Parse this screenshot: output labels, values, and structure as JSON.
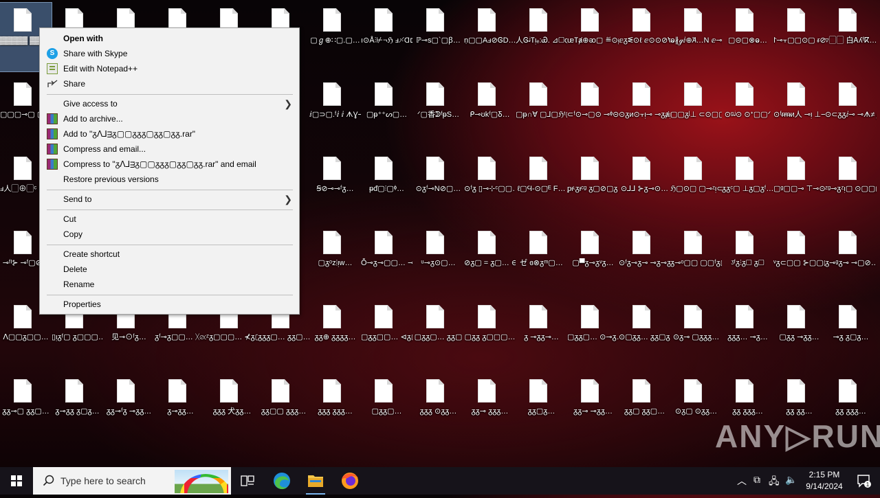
{
  "desktop": {
    "icons": [
      {
        "label": "▓▓▓▓▓ ▓▓▓ ic▢ ▀▀"
      },
      {
        "label": ""
      },
      {
        "label": ""
      },
      {
        "label": ""
      },
      {
        "label": ""
      },
      {
        "label": ""
      },
      {
        "label": "▢ℊ⊕∷▢.▢…"
      },
      {
        "label": "ı⊙Å⫶⊬¬ℌ ⅎ⸓Ɑ⊏ﾭ…"
      },
      {
        "label": "ℙ⊸ѕ▢`▢ꞵ…"
      },
      {
        "label": "ṇ▢▢Aⅎ⊘ᎶD…"
      },
      {
        "label": "人Ꮆᶨⴶᴉₑ:Ꮿ. ⊿▢ꝗ"
      },
      {
        "label": "ᵫⴶⱥ⊕ᴔ▢ ≝⊙ᵽ≣ᵂ…"
      },
      {
        "label": "ⅇᵹᓬ⊙ℓ ⅇ⊙⊙⊘Ɐ…"
      },
      {
        "label": "ⱺ∦ℊⅈ⊕Ꞻ…N ⅇ⊸ᵽ⁻ⁿ…"
      },
      {
        "label": "▢⊝▢⊗ⱺ…"
      },
      {
        "label": "⨡⊸⫟▢▢⊙▢ ᵲ⊘ꝗ夗…"
      },
      {
        "label": "▿▢▢ 白Ꭺʎᶠⴽ…"
      },
      {
        "label": "▢▢▢⊸▢ ▢●ᵽⴶᵳ…"
      },
      {
        "label": ""
      },
      {
        "label": ""
      },
      {
        "label": ""
      },
      {
        "label": ""
      },
      {
        "label": ""
      },
      {
        "label": "ⅈ▢⊃▢.ᶠⅈ ⅈ ᗑƔ⊸ℌ▢…"
      },
      {
        "label": "▢ᵽ⁺⁺ᔕ▢…"
      },
      {
        "label": "ᐟ▢香ᕲᶠᵽS…"
      },
      {
        "label": "ᑭ⊸ʊkᶠ▢Ᵹ…"
      },
      {
        "label": "▢ᵽ∩Ɐ ▢⅃▢ℌᵗ▢…"
      },
      {
        "label": "⊂ᶠ⊙⊸▢⊙ ⊸ᶲ⊝▢▢ᵱ…"
      },
      {
        "label": "⊙ᵹᴎ⊙⫟ᴉ⊸ ⊸ᵹⱥᴉ▢…"
      },
      {
        "label": "▢▢ᵹᶪ⊥ ⊂⊙▢▢≋"
      },
      {
        "label": "⊙ᶢᶨ⊙ ⊙ᐩ▢▢ᐟ"
      },
      {
        "label": "⊙ᶠᵲᵯᴎ人 ⊸ᴉ ⊥⊸ᶠ…"
      },
      {
        "label": "⊙⊂ᵹᵹⅈ⊸ ⊸ᗑ≠ℊ…"
      },
      {
        "label": "ⅎ人▢⊕▢ᶜ ▮▢ⱺᶜ⊙…"
      },
      {
        "label": ""
      },
      {
        "label": ""
      },
      {
        "label": ""
      },
      {
        "label": ""
      },
      {
        "label": ""
      },
      {
        "label": "Ꞩ⊘⊸⊸ᶠᵹ…"
      },
      {
        "label": "ᵽᵭ▢⫶▢ᶲ…"
      },
      {
        "label": "⊙ᵹᶠ⊸N⊘▢…"
      },
      {
        "label": "⊙ᶠᵹ ▯⊸⊹ᶜ▢▢…"
      },
      {
        "label": "ℓ▢Ϥ-⊙▢ᴱ F…"
      },
      {
        "label": "ᵱᵻᶫᵹᵻᶜᶢ ᵹ▢⊘▢ᵹ…"
      },
      {
        "label": "⊙⅃⅃ ⊱ᵹ⊸⊙…"
      },
      {
        "label": "ℌ▢⊙▢ ▢⊸ᶻᴉ⊂…"
      },
      {
        "label": "ᵹᵹᶜ▢ ⊥ᵹ▢ᵹᶠ…"
      },
      {
        "label": "▢ᶢ▢▢⊸ ⊤⊸⊙▢…"
      },
      {
        "label": "ᶻᶢ⊸ᵹᶻᴉ▢ ⊙▢▢▢⊙…"
      },
      {
        "label": "⊸ᶠᴵ⊱ ⊸ᶠ▢⊘▢"
      },
      {
        "label": ""
      },
      {
        "label": ""
      },
      {
        "label": ""
      },
      {
        "label": ""
      },
      {
        "label": ""
      },
      {
        "label": "▢ᵹᵒᴢ⦙ᴉw…"
      },
      {
        "label": "Ȭ⊸ᵹ⊸▢▢… ⊸ᵹ▢ℚ"
      },
      {
        "label": "ᵘ⊸ᵹ⊙▢…"
      },
      {
        "label": "⊘ᵹ▢ = ᵹ▢… ⊖⊸ᵹ▢▄"
      },
      {
        "label": "ゼ ɞ⊗ᵹᵐ▢…"
      },
      {
        "label": "▢▀ᵹ⊸ᵹᵛᵹ…"
      },
      {
        "label": "⊙ᶠᵹ⊸ᵹ⊸ ⊸ᵹ⊸ᵹ⊸…"
      },
      {
        "label": "ᵹ⊸ᵒ▢▢ ▢▢ᶠᵹ▢…"
      },
      {
        "label": "ᶾᶠᵹ⫶ᵹ▢ ᵹ▢"
      },
      {
        "label": "ᵛᵹ⊂▢▢ ⊱▢▢▢…"
      },
      {
        "label": "ᵹ⊸ᶢᵹ⊸ ⊸▢⊘…"
      },
      {
        "label": "ᐱ▢▢ᵹ▢▢…"
      },
      {
        "label": "▯ᴉᵹᶠ▢ ᵹ▢▢▢…"
      },
      {
        "label": "见⊸⊙ᶠᵹ…"
      },
      {
        "label": "ᵹᶠ⊸ᵹ▢▢… ᚷ⊘▢▢…"
      },
      {
        "label": "ᶻᵹ▢▢▢… ⊀ᵹ▢ᵹ…"
      },
      {
        "label": "ᵹᵹᵹ▢… ᵹᵹ▢…"
      },
      {
        "label": "ᵹᵹ⊕ ᵹᵹᵹᵹ…"
      },
      {
        "label": "▢ᵹᵹ▢▢… ⊲ᵹ▢…"
      },
      {
        "label": "▢ᵹᵹ▢… ᵹᵹ▢"
      },
      {
        "label": "▢ᵹᵹ ᵹ▢▢▢…"
      },
      {
        "label": "ᵹ ⊸ᵹᵹ⊸…"
      },
      {
        "label": "▢ᵹᵹ▢… ⊙⊸ᵹ…"
      },
      {
        "label": "⊙▢ᵹᵹ… ᵹᵹ▢ᵹ…"
      },
      {
        "label": "⊙ᵹ⊸ ▢ᵹᵹᵹ…"
      },
      {
        "label": "ᵹᵹᵹ… ⊸ᵹ…"
      },
      {
        "label": "▢ᵹᵹ ⊸ᵹᵹ…"
      },
      {
        "label": "⊸ᵹ ᵹ▢ᵹ…"
      },
      {
        "label": "ᵹᵹ⊸▢ ᵹᵹ▢…"
      },
      {
        "label": "ᵹ⊸ᵹᵹ ᵹ▢ᵹ…"
      },
      {
        "label": "ᵹᵹ⊸ᶠᵹ ⊸ᵹᵹ…"
      },
      {
        "label": "ᵹ⊸ᵹᵹ…"
      },
      {
        "label": "ᵹᵹᵹ 犬ᵹᵹ…"
      },
      {
        "label": "ᵹᵹ▢▢ ᵹᵹᵹ…"
      },
      {
        "label": "ᵹᵹᵹ ᵹᵹᵹ…"
      },
      {
        "label": "▢ᵹᵹ▢…"
      },
      {
        "label": "ᵹᵹᵹ ⊙ᵹᵹ…"
      },
      {
        "label": "ᵹᵹ⊸ ᵹᵹᵹ…"
      },
      {
        "label": "ᵹᵹ▢ᵹ…"
      },
      {
        "label": "ᵹᵹ⊸ ⊸ᵹᵹ…"
      },
      {
        "label": "ᵹᵹ▢ ᵹᵹ▢…"
      },
      {
        "label": "⊙ᵹ▢ ⊙ᵹᵹ…"
      },
      {
        "label": "ᵹᵹ ᵹᵹᵹ…"
      },
      {
        "label": "ᵹᵹ ᵹᵹ…"
      },
      {
        "label": "ᵹᵹ ᵹᵹᵹ…"
      }
    ]
  },
  "context_menu": {
    "open_with": "Open with",
    "share_skype": "Share with Skype",
    "edit_notepad": "Edit with Notepad++",
    "share": "Share",
    "give_access": "Give access to",
    "add_archive": "Add to archive...",
    "add_to_rar": "Add to \"ᵹᐱ⅃ᴟᵹ▢▢ᵹᵹᵹ▢ᵹᵹ▢ᵹᵹ.rar\"",
    "compress_email": "Compress and email...",
    "compress_to_rar_email": "Compress to \"ᵹᐱ⅃ᴟᵹ▢▢ᵹᵹᵹ▢ᵹᵹ▢ᵹᵹ.rar\" and email",
    "restore_versions": "Restore previous versions",
    "send_to": "Send to",
    "cut": "Cut",
    "copy": "Copy",
    "create_shortcut": "Create shortcut",
    "delete": "Delete",
    "rename": "Rename",
    "properties": "Properties"
  },
  "taskbar": {
    "search_placeholder": "Type here to search",
    "time": "2:15 PM",
    "date": "9/14/2024",
    "notification_count": "1"
  },
  "watermark": "ANY▷RUN",
  "colors": {
    "menu_bg": "#f2f2f2",
    "taskbar_bg": "#16131a",
    "accent": "#7cb7f0"
  }
}
